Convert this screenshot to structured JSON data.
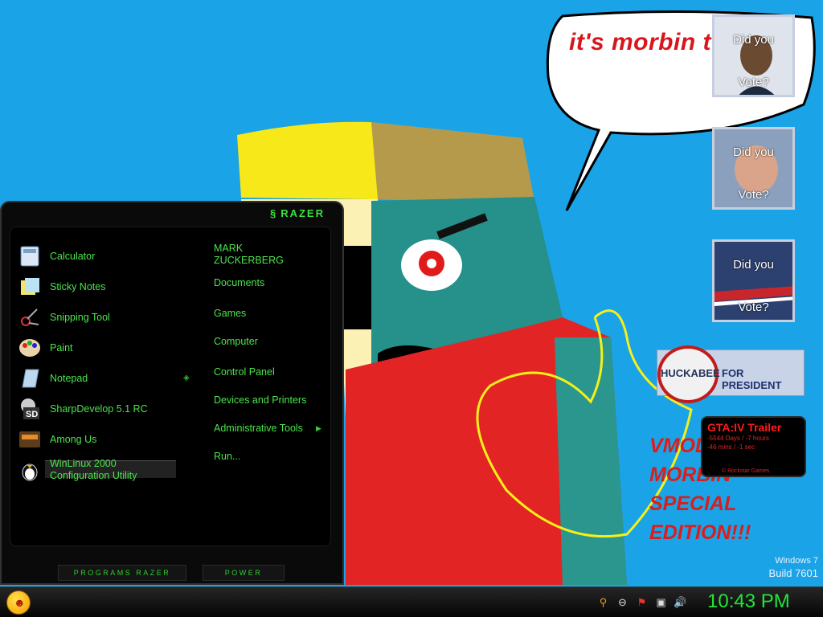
{
  "speech_bubble": "it's morbin t",
  "wallpaper_text": "VMODE MORBIN SPECIAL EDITION!!!",
  "windows_version": {
    "name": "Windows 7",
    "build": "Build 7601"
  },
  "vote_gadgets": [
    {
      "top": "Did you",
      "bottom": "Vote?"
    },
    {
      "top": "Did you",
      "bottom": "Vote?"
    },
    {
      "top": "Did you",
      "bottom": "Vote?"
    }
  ],
  "huckabee": {
    "name": "HUCKABEE",
    "suffix": "FOR PRESIDENT"
  },
  "gta": {
    "title": "GTA:IV Trailer",
    "line1": "-5544 Days / -7 hours",
    "line2": "-46 mins / -1 sec",
    "footer": "© Rockstar Games"
  },
  "start_menu": {
    "brand": "RAZER",
    "programs": [
      {
        "label": "Calculator",
        "icon": "calculator-icon"
      },
      {
        "label": "Sticky Notes",
        "icon": "sticky-notes-icon"
      },
      {
        "label": "Snipping Tool",
        "icon": "scissors-icon"
      },
      {
        "label": "Paint",
        "icon": "palette-icon"
      },
      {
        "label": "Notepad",
        "icon": "notepad-icon"
      },
      {
        "label": "SharpDevelop 5.1 RC",
        "icon": "sd-icon"
      },
      {
        "label": "Among Us",
        "icon": "among-us-icon"
      },
      {
        "label": "WinLinux 2000\nConfiguration Utility",
        "icon": "penguin-icon"
      }
    ],
    "right_items": [
      "MARK\nZUCKERBERG",
      "Documents",
      "Games",
      "Computer",
      "Control Panel",
      "Devices and Printers",
      "Administrative Tools",
      "Run..."
    ],
    "programs_button": "PROGRAMS RAZER",
    "power_button": "POWER"
  },
  "taskbar": {
    "clock": "10:43 PM",
    "tray_icons": [
      "search-icon",
      "status-icon",
      "flag-icon",
      "network-icon",
      "volume-icon"
    ]
  }
}
